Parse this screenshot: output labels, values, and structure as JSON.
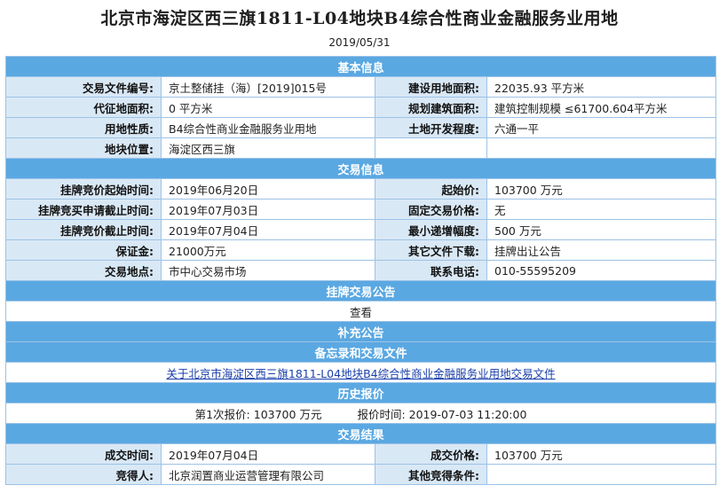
{
  "title": "北京市海淀区西三旗1811-L04地块B4综合性商业金融服务业用地",
  "date": "2019/05/31",
  "basic": {
    "header": "基本信息",
    "doc_no_label": "交易文件编号:",
    "doc_no": "京土整储挂（海）[2019]015号",
    "build_area_label": "建设用地面积:",
    "build_area": "22035.93 平方米",
    "agent_area_label": "代征地面积:",
    "agent_area": "0 平方米",
    "plan_area_label": "规划建筑面积:",
    "plan_area": "建筑控制规模 ≤61700.604平方米",
    "land_use_label": "用地性质:",
    "land_use": "B4综合性商业金融服务业用地",
    "dev_level_label": "土地开发程度:",
    "dev_level": "六通一平",
    "location_label": "地块位置:",
    "location": "海淀区西三旗"
  },
  "trade": {
    "header": "交易信息",
    "start_time_label": "挂牌竞价起始时间:",
    "start_time": "2019年06月20日",
    "start_price_label": "起始价:",
    "start_price": "103700 万元",
    "apply_end_label": "挂牌竞买申请截止时间:",
    "apply_end": "2019年07月03日",
    "fixed_price_label": "固定交易价格:",
    "fixed_price": "无",
    "bid_end_label": "挂牌竞价截止时间:",
    "bid_end": "2019年07月04日",
    "min_increment_label": "最小递增幅度:",
    "min_increment": "500 万元",
    "deposit_label": "保证金:",
    "deposit": "21000万元",
    "other_files_label": "其它文件下载:",
    "other_files": "挂牌出让公告",
    "venue_label": "交易地点:",
    "venue": "市中心交易市场",
    "phone_label": "联系电话:",
    "phone": "010-55595209"
  },
  "notice": {
    "header": "挂牌交易公告",
    "view": "查看"
  },
  "supplement": {
    "header": "补充公告"
  },
  "memo": {
    "header": "备忘录和交易文件",
    "link": "关于北京市海淀区西三旗1811-L04地块B4综合性商业金融服务业用地交易文件"
  },
  "history": {
    "header": "历史报价",
    "offer": "第1次报价: 103700 万元",
    "offer_time": "报价时间: 2019-07-03 11:20:00"
  },
  "result": {
    "header": "交易结果",
    "deal_time_label": "成交时间:",
    "deal_time": "2019年07月04日",
    "deal_price_label": "成交价格:",
    "deal_price": "103700 万元",
    "bidder_label": "竞得人:",
    "bidder": "北京润置商业运营管理有限公司",
    "other_cond_label": "其他竞得条件:",
    "other_cond": ""
  },
  "colors": {
    "section_header": "#5aa8e2",
    "label_cell": "#d9e8f5",
    "border": "#9cc3e6",
    "link": "#1a3faa"
  }
}
